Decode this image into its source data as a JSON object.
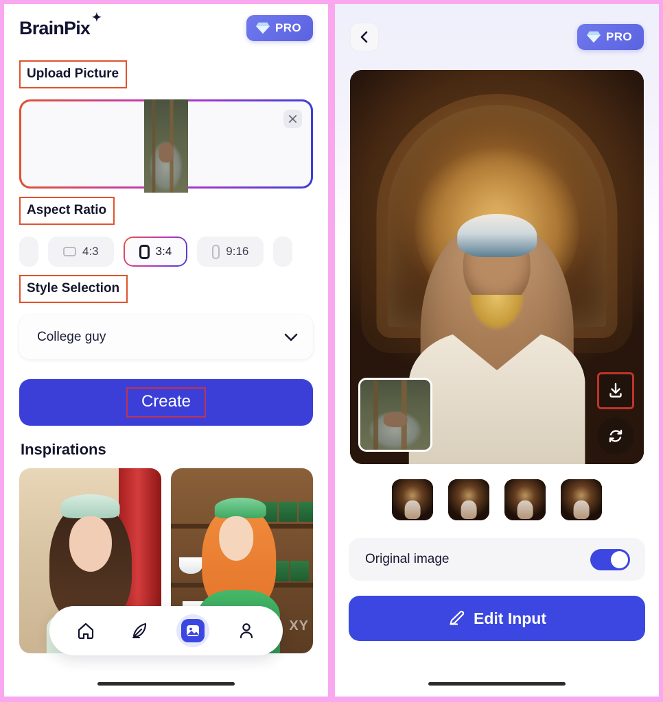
{
  "left": {
    "brand": "BrainPix",
    "brand_spark_icon": "sparkle-icon",
    "pro_label": "PRO",
    "upload_section_label": "Upload Picture",
    "upload": {
      "remove_icon": "close-icon",
      "thumb_alt": "uploaded-photo-of-man"
    },
    "aspect_section_label": "Aspect Ratio",
    "aspect_options": [
      {
        "label": "4:3",
        "icon": "rect-landscape-icon",
        "selected": false
      },
      {
        "label": "3:4",
        "icon": "rect-portrait-icon",
        "selected": true
      },
      {
        "label": "9:16",
        "icon": "rect-narrow-icon",
        "selected": false
      }
    ],
    "style_section_label": "Style Selection",
    "style_value": "College guy",
    "style_chevron_icon": "chevron-down-icon",
    "create_label": "Create",
    "inspirations_title": "Inspirations",
    "inspirations": [
      {
        "alt": "maid-girl-red-curtain-artwork"
      },
      {
        "alt": "orange-hair-girl-shelf-artwork",
        "watermark": "XY"
      }
    ],
    "nav": [
      {
        "name": "home",
        "icon": "home-icon",
        "active": false
      },
      {
        "name": "create",
        "icon": "feather-pen-icon",
        "active": false
      },
      {
        "name": "gallery",
        "icon": "image-icon",
        "active": true
      },
      {
        "name": "profile",
        "icon": "person-icon",
        "active": false
      }
    ]
  },
  "right": {
    "back_icon": "chevron-left-icon",
    "pro_label": "PRO",
    "hero": {
      "alt": "generated-ancient-king-portrait",
      "mini_alt": "original-uploaded-photo",
      "download_icon": "download-icon",
      "refresh_icon": "refresh-icon"
    },
    "thumbnails": [
      {
        "alt": "result-1",
        "selected": true
      },
      {
        "alt": "result-2",
        "selected": false
      },
      {
        "alt": "result-3",
        "selected": false
      },
      {
        "alt": "result-4",
        "selected": false
      }
    ],
    "original_image_label": "Original image",
    "original_image_on": true,
    "edit_input_label": "Edit Input",
    "edit_icon": "pencil-icon"
  },
  "colors": {
    "frame_pink": "#f9a8f0",
    "primary_blue": "#3b47e0",
    "highlight_red": "#e0522c",
    "gradient_start": "#e0522c",
    "gradient_mid": "#bf33c6",
    "gradient_end": "#3b3fd8"
  }
}
